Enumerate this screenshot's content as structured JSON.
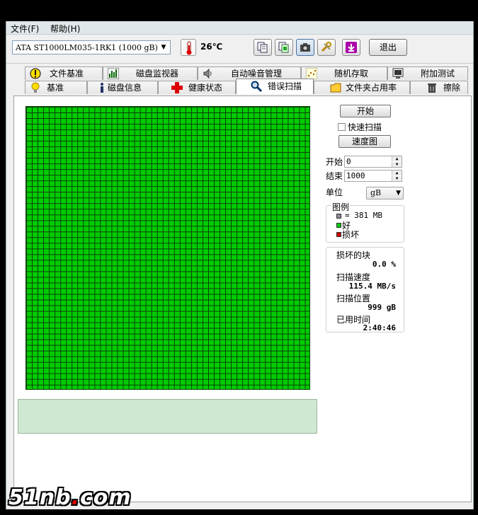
{
  "menu": {
    "file": "文件(F)",
    "help": "帮助(H)"
  },
  "toolbar": {
    "drive": "ATA    ST1000LM035-1RK1  (1000  gB)",
    "temperature": "26℃",
    "exit_label": "退出",
    "buttons": [
      "copy-icon",
      "copy-green-icon",
      "camera-icon",
      "tools-icon",
      "download-icon"
    ]
  },
  "tabs_top": [
    {
      "label": "文件基准",
      "icon": "exclamation-icon"
    },
    {
      "label": "磁盘监视器",
      "icon": "chart-icon"
    },
    {
      "label": "自动噪音管理",
      "icon": "speaker-icon"
    },
    {
      "label": "随机存取",
      "icon": "dots-icon"
    },
    {
      "label": "附加测试",
      "icon": "monitor-icon"
    }
  ],
  "tabs_bottom": [
    {
      "label": "基准",
      "icon": "bulb-icon"
    },
    {
      "label": "磁盘信息",
      "icon": "info-icon"
    },
    {
      "label": "健康状态",
      "icon": "cross-icon"
    },
    {
      "label": "错误扫描",
      "icon": "magnifier-icon",
      "active": true
    },
    {
      "label": "文件夹占用率",
      "icon": "folder-icon"
    },
    {
      "label": "擦除",
      "icon": "trash-icon"
    }
  ],
  "scan": {
    "start_button": "开始",
    "quick_scan_label": "快速扫描",
    "quick_scan_checked": false,
    "speed_map_button": "速度图",
    "start_label": "开始",
    "start_value": "0",
    "end_label": "结束",
    "end_value": "1000",
    "unit_label": "单位",
    "unit_value": "gB"
  },
  "legend": {
    "title": "图例",
    "block_size": "= 381 MB",
    "good": "好",
    "bad": "损坏",
    "colors": {
      "block": "#8a8a9a",
      "good": "#00cc00",
      "bad": "#cc0000"
    }
  },
  "stats": {
    "damaged_label": "损坏的块",
    "damaged_value": "0.0 %",
    "speed_label": "扫描速度",
    "speed_value": "115.4 MB/s",
    "position_label": "扫描位置",
    "position_value": "999 gB",
    "elapsed_label": "已用时间",
    "elapsed_value": "2:40:46"
  },
  "grid": {
    "columns": 50,
    "rows": 50,
    "status": "good",
    "color": "#00cc00"
  },
  "watermark": {
    "text_main": "51nb",
    "text_dot": ".",
    "text_tail": "com"
  }
}
